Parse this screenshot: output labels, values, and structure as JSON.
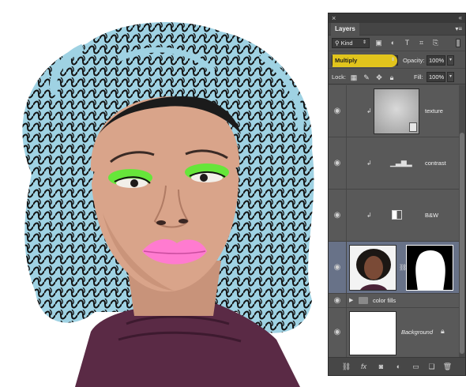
{
  "panel": {
    "close": "×",
    "collapse": "«",
    "tab_label": "Layers",
    "menu_icon": "panel-menu-icon",
    "menu_glyph": "▾≡",
    "filter": {
      "kind_label": "Kind",
      "icons": [
        "image-filter-icon",
        "adjustment-filter-icon",
        "type-filter-icon",
        "shape-filter-icon",
        "smart-object-filter-icon"
      ]
    },
    "blend_mode": "Multiply",
    "opacity_label": "Opacity:",
    "opacity_value": "100%",
    "lock_label": "Lock:",
    "fill_label": "Fill:",
    "fill_value": "100%",
    "highlight_color": "#f4d41a",
    "selected_color": "#687288"
  },
  "layers": [
    {
      "name": "texture",
      "type": "texture",
      "clipped": true
    },
    {
      "name": "contrast",
      "type": "levels-adjustment",
      "clipped": true
    },
    {
      "name": "B&W",
      "type": "black-white-adjustment",
      "clipped": true
    },
    {
      "name": "",
      "type": "portrait-with-mask",
      "selected": true
    },
    {
      "name": "color fills",
      "type": "group"
    },
    {
      "name": "Background",
      "type": "background",
      "locked": true
    }
  ],
  "bottom_icons": [
    "link-icon",
    "fx-icon",
    "mask-icon",
    "adjustment-icon",
    "folder-icon",
    "new-layer-icon",
    "trash-icon"
  ],
  "artwork": {
    "hair_color": "#9fd2e3",
    "skin_color": "#d9a48a",
    "eyeshadow_color": "#66e63a",
    "lip_color": "#ff7bd0",
    "sweater_color": "#5a2a45"
  }
}
